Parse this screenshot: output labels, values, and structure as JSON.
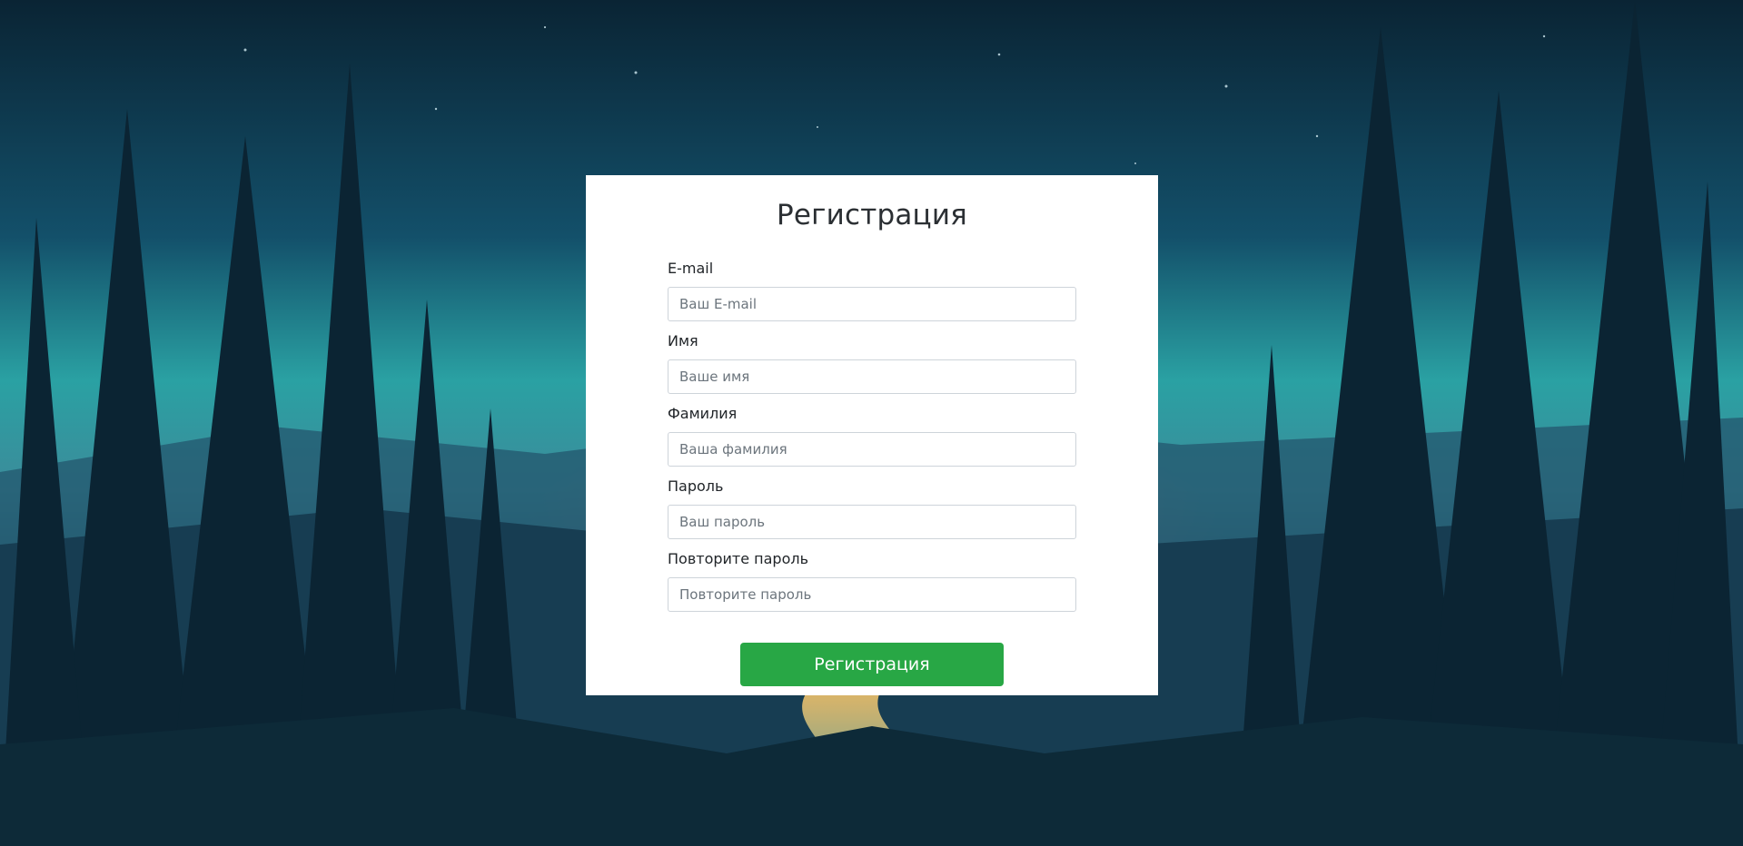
{
  "form": {
    "title": "Регистрация",
    "fields": [
      {
        "label": "E-mail",
        "placeholder": "Ваш E-mail",
        "value": ""
      },
      {
        "label": "Имя",
        "placeholder": "Ваше имя",
        "value": ""
      },
      {
        "label": "Фамилия",
        "placeholder": "Ваша фамилия",
        "value": ""
      },
      {
        "label": "Пароль",
        "placeholder": "Ваш пароль",
        "value": ""
      },
      {
        "label": "Повторите пароль",
        "placeholder": "Повторите пароль",
        "value": ""
      }
    ],
    "submit_label": "Регистрация"
  },
  "colors": {
    "submit_bg": "#28a745",
    "card_bg": "#ffffff",
    "sky_top": "#0b2a3b",
    "sky_glow": "#2aa6a6",
    "forest_dark": "#0a1f2c"
  }
}
